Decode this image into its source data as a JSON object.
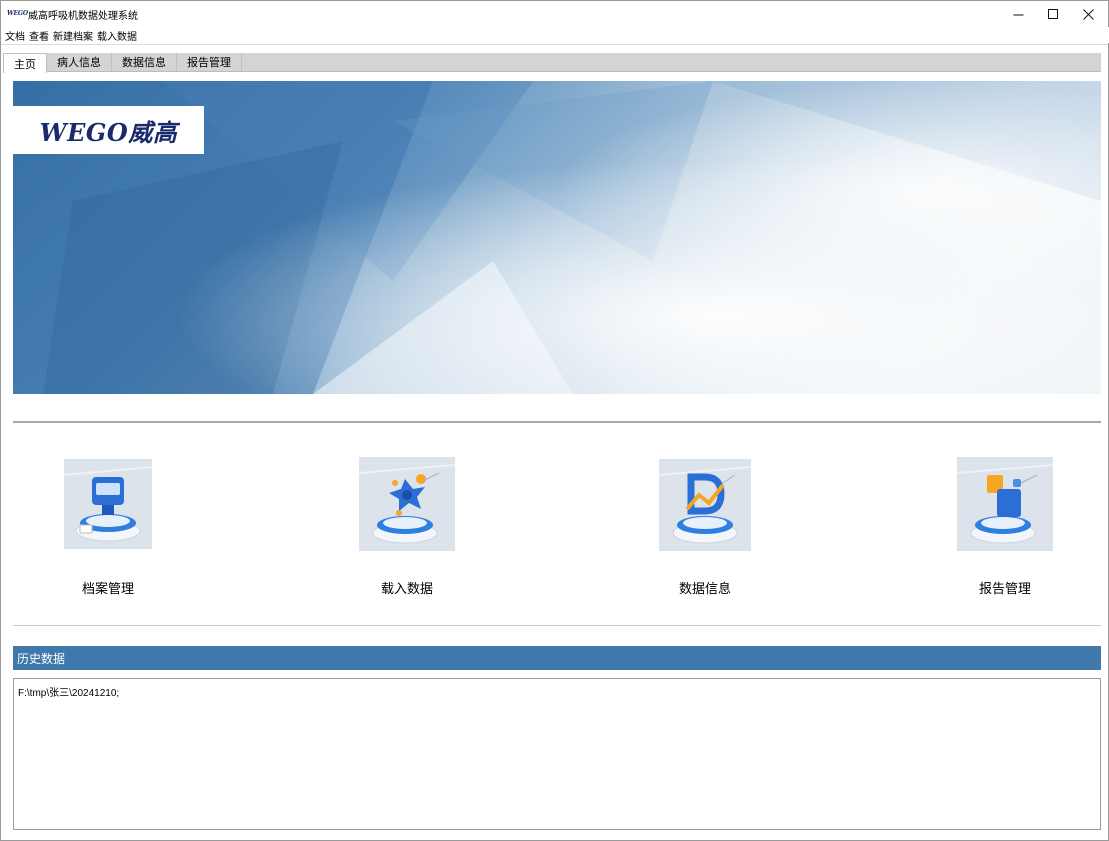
{
  "window": {
    "title": "威高呼吸机数据处理系统",
    "icon_text": "WEGO"
  },
  "menu": [
    "文档",
    "查看",
    "新建档案",
    "载入数据"
  ],
  "tabs": [
    {
      "label": "主页",
      "active": true
    },
    {
      "label": "病人信息",
      "active": false
    },
    {
      "label": "数据信息",
      "active": false
    },
    {
      "label": "报告管理",
      "active": false
    }
  ],
  "banner": {
    "logo": "WEGO威高"
  },
  "features": [
    {
      "label": "档案管理",
      "icon": "archive-icon"
    },
    {
      "label": "载入数据",
      "icon": "load-data-icon"
    },
    {
      "label": "数据信息",
      "icon": "data-info-icon"
    },
    {
      "label": "报告管理",
      "icon": "report-icon"
    }
  ],
  "history": {
    "title": "历史数据",
    "items": [
      "F:\\tmp\\张三\\20241210;"
    ]
  },
  "colors": {
    "accent": "#3f78ab",
    "logo": "#1a2a6c",
    "tab_bg": "#d4d4d4"
  }
}
